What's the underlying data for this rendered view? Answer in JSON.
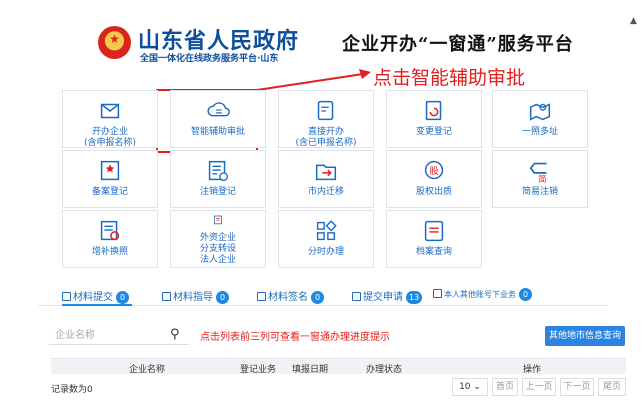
{
  "header": {
    "gov_title": "山东省人民政府",
    "gov_subtitle": "全国一体化在线政务服务平台·山东",
    "platform_title": "企业开办“一窗通”服务平台"
  },
  "callout": {
    "text": "点击智能辅助审批",
    "color": "#e02020"
  },
  "tiles": [
    {
      "icon": "business-start-icon",
      "line1": "开办企业",
      "line2": "(含申报名称)"
    },
    {
      "icon": "smart-assist-icon",
      "line1": "智能辅助审批",
      "line2": ""
    },
    {
      "icon": "direct-start-icon",
      "line1": "直接开办",
      "line2": "(含已申报名称)"
    },
    {
      "icon": "change-register-icon",
      "line1": "变更登记",
      "line2": ""
    },
    {
      "icon": "one-license-icon",
      "line1": "一照多址",
      "line2": ""
    },
    {
      "icon": "filing-icon",
      "line1": "备案登记",
      "line2": ""
    },
    {
      "icon": "cancel-register-icon",
      "line1": "注销登记",
      "line2": ""
    },
    {
      "icon": "relocation-icon",
      "line1": "市内迁移",
      "line2": ""
    },
    {
      "icon": "equity-pledge-icon",
      "line1": "股权出质",
      "line2": ""
    },
    {
      "icon": "simple-cancel-icon",
      "line1": "简易注销",
      "line2": ""
    },
    {
      "icon": "reissue-icon",
      "line1": "增补换照",
      "line2": ""
    },
    {
      "icon": "foreign-enterprise-icon",
      "line1": "外资企业",
      "line2": "分支转设",
      "line3": "法人企业"
    },
    {
      "icon": "branch-icon",
      "line1": "分时办理",
      "line2": ""
    },
    {
      "icon": "archive-query-icon",
      "line1": "档案查询",
      "line2": ""
    }
  ],
  "tabs": [
    {
      "label": "材料提交",
      "count": "0"
    },
    {
      "label": "材料指导",
      "count": "0"
    },
    {
      "label": "材料签名",
      "count": "0"
    },
    {
      "label": "提交申请",
      "count": "13"
    },
    {
      "label": "本人其他账号下业务",
      "count": "0"
    }
  ],
  "search": {
    "placeholder": "企业名称"
  },
  "hint": "点击列表前三列可查看一窗通办理进度提示",
  "query_button": "其他地市信息查询",
  "table": {
    "columns": [
      "企业名称",
      "登记业务",
      "填报日期",
      "办理状态",
      "操作"
    ]
  },
  "records": "记录数为0",
  "pagination": {
    "page_size": "10",
    "first": "首页",
    "prev": "上一页",
    "next": "下一页",
    "last": "尾页"
  },
  "colors": {
    "brand_blue": "#0b4e9c",
    "accent": "#1e88e5",
    "alert": "#e02020"
  }
}
